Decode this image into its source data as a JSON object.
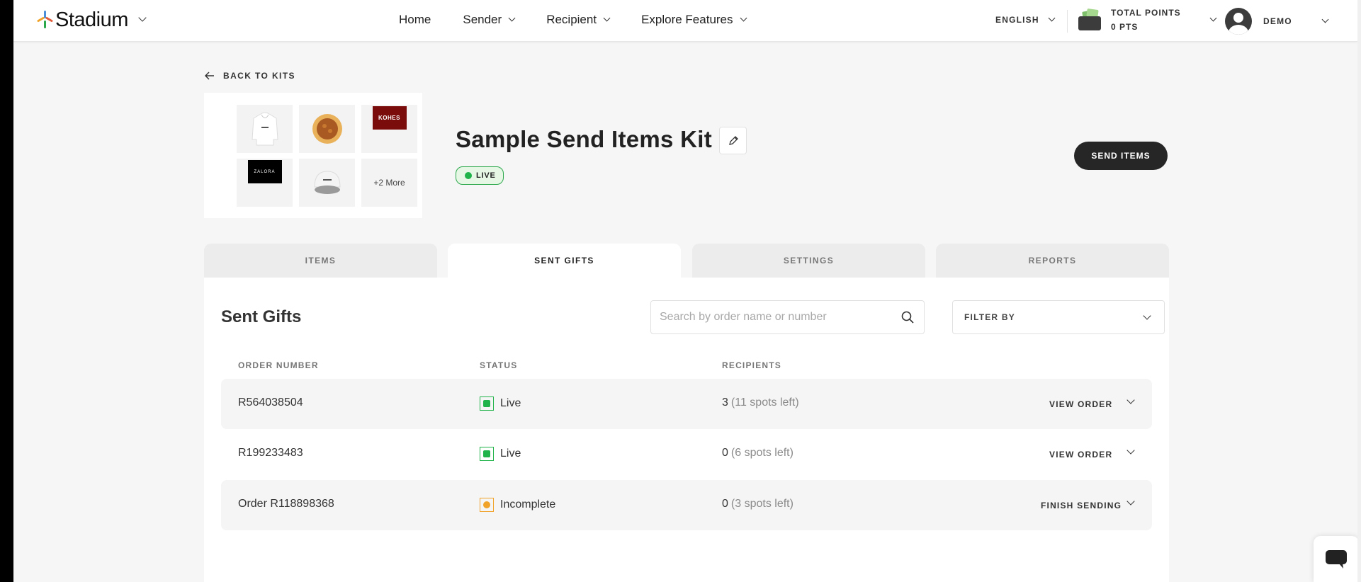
{
  "brand": {
    "name": "Stadium"
  },
  "nav": {
    "links": [
      {
        "label": "Home"
      },
      {
        "label": "Sender"
      },
      {
        "label": "Recipient"
      },
      {
        "label": "Explore Features"
      }
    ]
  },
  "language": "ENGLISH",
  "points": {
    "label": "TOTAL POINTS",
    "value": "0 PTS"
  },
  "user": {
    "name": "DEMO"
  },
  "back_label": "BACK TO KITS",
  "kit": {
    "title": "Sample Send Items Kit",
    "status": "LIVE",
    "thumbnails": {
      "logo_text": "KOHES",
      "zalora_text": "ZALORA",
      "more_label": "+2 More"
    },
    "send_button": "SEND ITEMS"
  },
  "tabs": [
    {
      "label": "ITEMS",
      "active": false
    },
    {
      "label": "SENT GIFTS",
      "active": true
    },
    {
      "label": "SETTINGS",
      "active": false
    },
    {
      "label": "REPORTS",
      "active": false
    }
  ],
  "sent_gifts": {
    "title": "Sent Gifts",
    "search_placeholder": "Search by order name or number",
    "filter_label": "FILTER BY",
    "columns": [
      "ORDER NUMBER",
      "STATUS",
      "RECIPIENTS"
    ],
    "rows": [
      {
        "order": "R564038504",
        "status": "Live",
        "count": "3",
        "spots": "(11 spots left)",
        "action": "VIEW ORDER",
        "status_color": "#20b34a"
      },
      {
        "order": "R199233483",
        "status": "Live",
        "count": "0",
        "spots": "(6 spots left)",
        "action": "VIEW ORDER",
        "status_color": "#20b34a"
      },
      {
        "order": "Order R118898368",
        "status": "Incomplete",
        "count": "0",
        "spots": "(3 spots left)",
        "action": "FINISH SENDING",
        "status_color": "#f0a328"
      }
    ]
  },
  "colors": {
    "live": "#20b34a",
    "incomplete": "#f0a328",
    "button_dark": "#262626"
  },
  "icons": [
    "chevron-down-icon",
    "arrow-left-icon",
    "pencil-icon",
    "search-icon",
    "wallet-icon",
    "avatar-icon",
    "chat-icon"
  ]
}
